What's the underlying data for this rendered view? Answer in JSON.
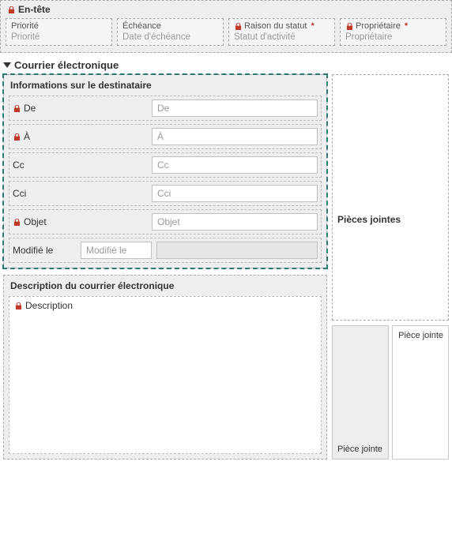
{
  "header": {
    "title": "En-tête",
    "fields": {
      "priorite": {
        "label": "Priorité",
        "placeholder": "Priorité"
      },
      "echeance": {
        "label": "Échéance",
        "placeholder": "Date d'échéance"
      },
      "raison": {
        "label": "Raison du statut",
        "placeholder": "Statut d'activité",
        "locked": true,
        "required": true
      },
      "proprietaire": {
        "label": "Propriétaire",
        "placeholder": "Propriétaire",
        "locked": true,
        "required": true
      }
    }
  },
  "email_section": {
    "title": "Courrier électronique",
    "recipient_info": {
      "title": "Informations sur le destinataire",
      "from": {
        "label": "De",
        "placeholder": "De"
      },
      "to": {
        "label": "À",
        "placeholder": "À"
      },
      "cc": {
        "label": "Cc",
        "placeholder": "Cc"
      },
      "bcc": {
        "label": "Cci",
        "placeholder": "Cci"
      },
      "subject": {
        "label": "Objet",
        "placeholder": "Objet"
      },
      "modified": {
        "label": "Modifié le",
        "placeholder": "Modifié le"
      }
    },
    "description": {
      "title": "Description du courrier électronique",
      "label": "Description"
    },
    "attachments": {
      "title": "Pièces jointes",
      "left_label": "Pièce jointe",
      "right_label": "Pièce jointe"
    }
  }
}
